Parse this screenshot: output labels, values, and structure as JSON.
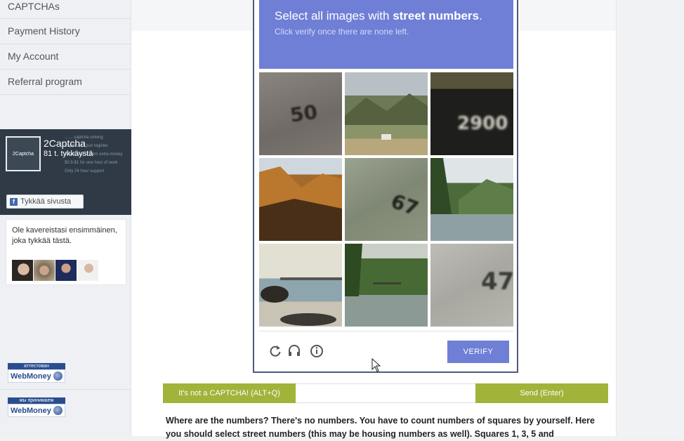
{
  "sidebar": {
    "items": [
      {
        "label": "CAPTCHAs"
      },
      {
        "label": "Payment History"
      },
      {
        "label": "My Account"
      },
      {
        "label": "Referral program"
      }
    ]
  },
  "facebook_widget": {
    "logo_text": "2Captcha",
    "page_name": "2Captcha",
    "likes": "81 t. tykkäystä",
    "background_lines": [
      "... ... captcha solving",
      "Captchas - just register",
      "Great way to earn extra money",
      "$0.5-$1 for one hour of work",
      "Only 24 hour support"
    ],
    "like_button": "Tykkää sivusta",
    "friends_text": "Ole kavereistasi ensimmäinen, joka tykkää tästä."
  },
  "webmoney": [
    {
      "tag": "аттестован",
      "brand": "WebMoney"
    },
    {
      "tag": "мы принимаем",
      "brand": "WebMoney"
    }
  ],
  "captcha": {
    "title_prefix": "Select all images with ",
    "title_bold": "street numbers",
    "title_suffix": ".",
    "subtitle": "Click verify once there are none left.",
    "tiles": [
      {
        "kind": "number",
        "text": "50"
      },
      {
        "kind": "landscape"
      },
      {
        "kind": "number",
        "text": "2900"
      },
      {
        "kind": "canyon"
      },
      {
        "kind": "number",
        "text": "67"
      },
      {
        "kind": "lake"
      },
      {
        "kind": "beach"
      },
      {
        "kind": "river"
      },
      {
        "kind": "number",
        "text": "47"
      }
    ],
    "icons": [
      "reload-icon",
      "audio-icon",
      "info-icon"
    ],
    "verify_label": "VERIFY"
  },
  "actions": {
    "not_captcha_label": "It's not a CAPTCHA! (ALT+Q)",
    "send_label": "Send (Enter)"
  },
  "instructions": "Where are the numbers? There's no numbers. You have to count numbers of squares by yourself. Here you should select street numbers (this may be housing numbers as well). Squares 1, 3, 5 and",
  "colors": {
    "accent": "#6f7fd6",
    "action_green": "#a2b33a"
  }
}
